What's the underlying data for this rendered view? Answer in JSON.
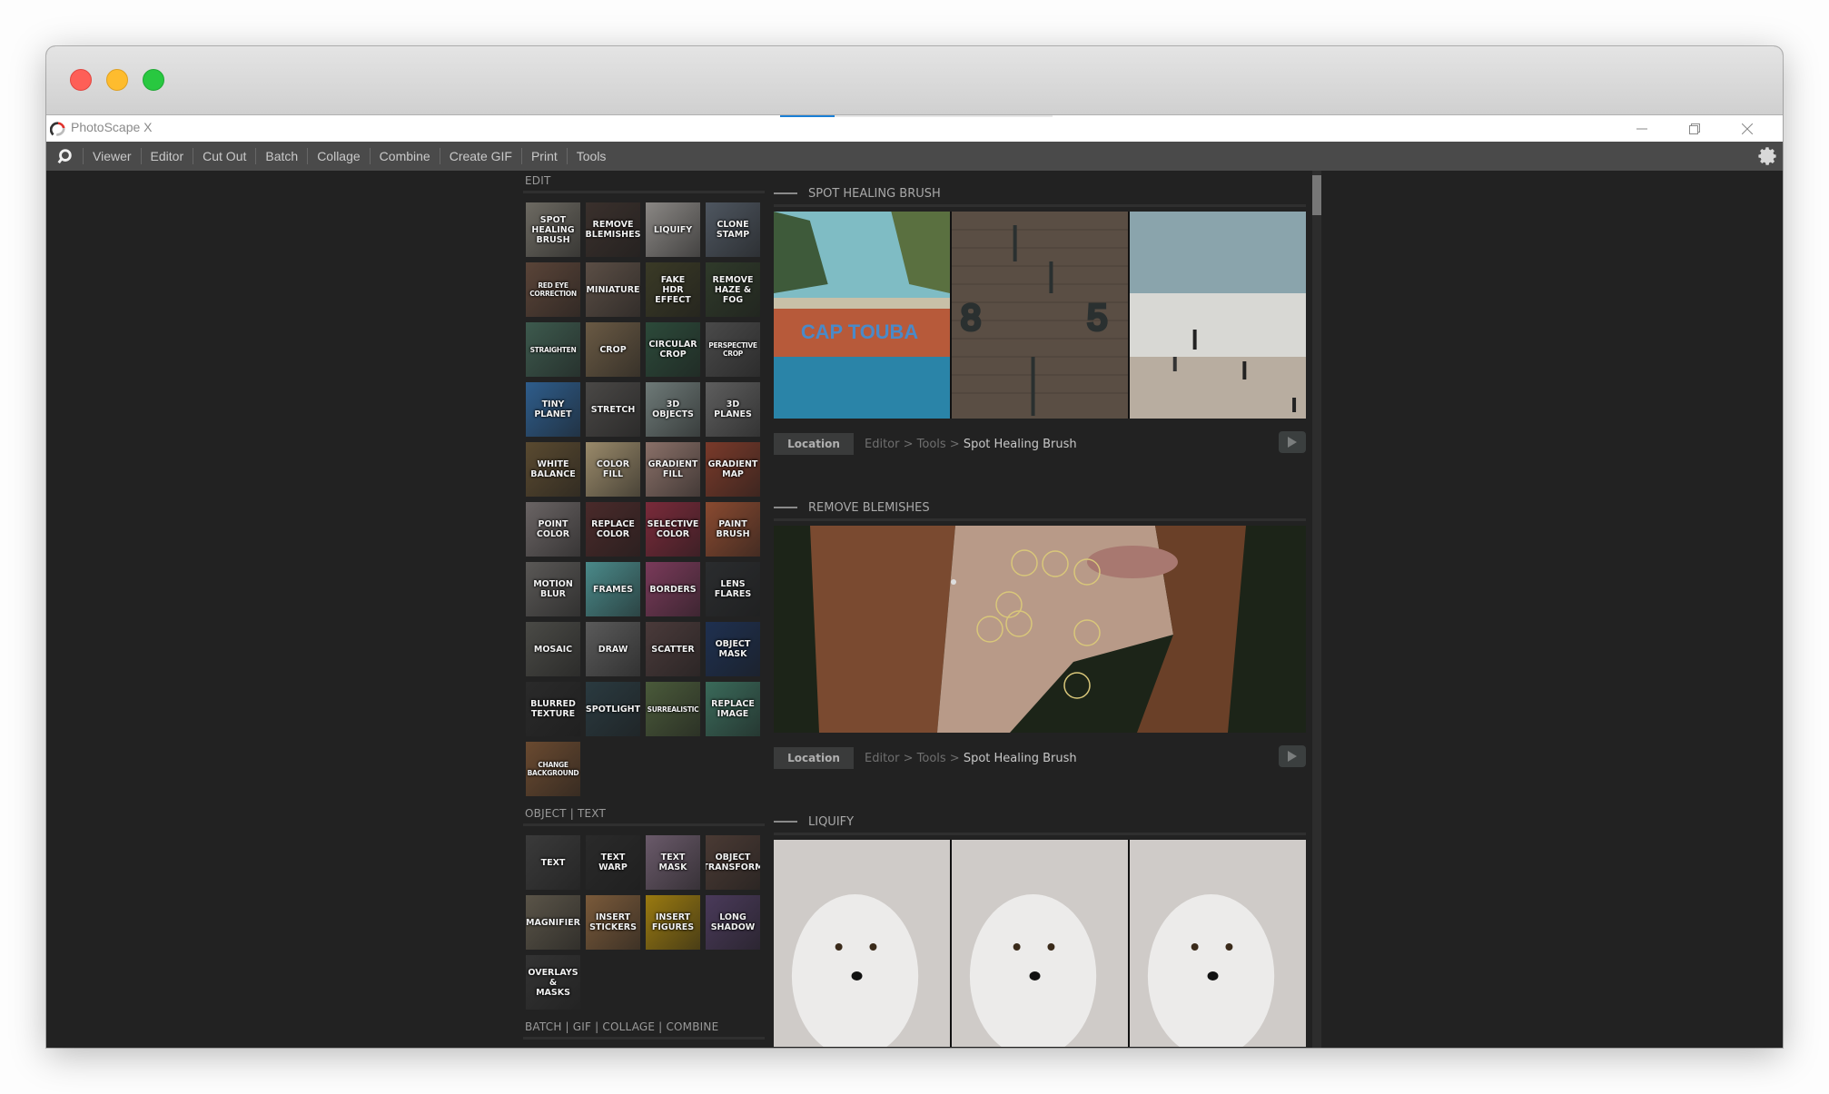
{
  "window": {
    "app_title": "PhotoScape X",
    "controls": {
      "minimize_icon": "minimize-icon",
      "maximize_icon": "restore-icon",
      "close_icon": "close-icon"
    }
  },
  "nav": {
    "logo_icon": "photoscape-logo-icon",
    "items": [
      "Viewer",
      "Editor",
      "Cut Out",
      "Batch",
      "Collage",
      "Combine",
      "Create GIF",
      "Print",
      "Tools"
    ],
    "settings_icon": "gear-icon"
  },
  "tools": {
    "edit_section": {
      "label": "EDIT",
      "tiles": [
        {
          "label": "SPOT\nHEALING\nBRUSH",
          "bg": "#6d6a62"
        },
        {
          "label": "REMOVE\nBLEMISHES",
          "bg": "#3a302c"
        },
        {
          "label": "LIQUIFY",
          "bg": "#8a8784"
        },
        {
          "label": "CLONE\nSTAMP",
          "bg": "#4e5660"
        },
        {
          "label": "RED EYE\nCORRECTION",
          "bg": "#5a4438",
          "small": true
        },
        {
          "label": "MINIATURE",
          "bg": "#5b4e45"
        },
        {
          "label": "FAKE\nHDR EFFECT",
          "bg": "#3a3a26"
        },
        {
          "label": "REMOVE\nHAZE & FOG",
          "bg": "#2f3a2a"
        },
        {
          "label": "STRAIGHTEN",
          "bg": "#3d5a4e",
          "small": true
        },
        {
          "label": "CROP",
          "bg": "#6a5a44"
        },
        {
          "label": "CIRCULAR\nCROP",
          "bg": "#2c4a3a"
        },
        {
          "label": "PERSPECTIVE\nCROP",
          "bg": "#4a4a4a",
          "small": true
        },
        {
          "label": "TINY\nPLANET",
          "bg": "#2e5d8c"
        },
        {
          "label": "STRETCH",
          "bg": "#4a4846"
        },
        {
          "label": "3D\nOBJECTS",
          "bg": "#6e7a78"
        },
        {
          "label": "3D\nPLANES",
          "bg": "#5e5e5e"
        },
        {
          "label": "WHITE\nBALANCE",
          "bg": "#5a4a30"
        },
        {
          "label": "COLOR\nFILL",
          "bg": "#9a8a6a"
        },
        {
          "label": "GRADIENT\nFILL",
          "bg": "#8a7068"
        },
        {
          "label": "GRADIENT\nMAP",
          "bg": "#7a3a2a"
        },
        {
          "label": "POINT\nCOLOR",
          "bg": "#6a6464"
        },
        {
          "label": "REPLACE\nCOLOR",
          "bg": "#4a2a2a"
        },
        {
          "label": "SELECTIVE\nCOLOR",
          "bg": "#7a2a3a"
        },
        {
          "label": "PAINT\nBRUSH",
          "bg": "#8a4a30"
        },
        {
          "label": "MOTION\nBLUR",
          "bg": "#5a5856"
        },
        {
          "label": "FRAMES",
          "bg": "#4a8a8a"
        },
        {
          "label": "BORDERS",
          "bg": "#7a3a5a"
        },
        {
          "label": "LENS\nFLARES",
          "bg": "#2a2c2e"
        },
        {
          "label": "MOSAIC",
          "bg": "#4a4a46"
        },
        {
          "label": "DRAW",
          "bg": "#5a5a5a"
        },
        {
          "label": "SCATTER",
          "bg": "#4a3a3a"
        },
        {
          "label": "OBJECT\nMASK",
          "bg": "#1e3050"
        },
        {
          "label": "BLURRED\nTEXTURE",
          "bg": "#2a2a2a"
        },
        {
          "label": "SPOTLIGHT",
          "bg": "#2a3a40"
        },
        {
          "label": "SURREALISTIC",
          "bg": "#4a5a3a",
          "small": true
        },
        {
          "label": "REPLACE\nIMAGE",
          "bg": "#3a6a5a"
        },
        {
          "label": "CHANGE\nBACKGROUND",
          "bg": "#6a4a30",
          "small": true
        }
      ]
    },
    "object_section": {
      "label": "OBJECT | TEXT",
      "tiles": [
        {
          "label": "TEXT",
          "bg": "#3a3a3a"
        },
        {
          "label": "TEXT\nWARP",
          "bg": "#2a2a2a"
        },
        {
          "label": "TEXT\nMASK",
          "bg": "#6a5a6a"
        },
        {
          "label": "OBJECT\nTRANSFORM",
          "bg": "#4a3a34"
        },
        {
          "label": "MAGNIFIER",
          "bg": "#5a5448"
        },
        {
          "label": "INSERT\nSTICKERS",
          "bg": "#7a5a3a"
        },
        {
          "label": "INSERT\nFIGURES",
          "bg": "#9a7a10"
        },
        {
          "label": "LONG\nSHADOW",
          "bg": "#4a3a5a"
        },
        {
          "label": "OVERLAYS\n&\nMASKS",
          "bg": "#333333"
        }
      ]
    },
    "batch_section": {
      "label": "BATCH | GIF | COLLAGE | COMBINE"
    }
  },
  "features": [
    {
      "title": "SPOT HEALING BRUSH",
      "images": [
        "boat-sign-cap-touba",
        "brick-wall-numbers",
        "beach-people"
      ],
      "location_label": "Location",
      "crumb_prefix": "Editor > Tools > ",
      "crumb_current": "Spot Healing Brush",
      "play_icon": "play-icon"
    },
    {
      "title": "REMOVE BLEMISHES",
      "images": [
        "woman-face-blemishes"
      ],
      "location_label": "Location",
      "crumb_prefix": "Editor > Tools > ",
      "crumb_current": "Spot Healing Brush",
      "play_icon": "play-icon"
    },
    {
      "title": "LIQUIFY",
      "images": [
        "arctic-fox",
        "arctic-fox",
        "arctic-fox"
      ]
    }
  ],
  "colors": {
    "accent_blue": "#1a7fd6",
    "panel_bg": "#222222",
    "nav_bg": "#4a4a4a",
    "blemish_circle": "#d9c77a"
  }
}
